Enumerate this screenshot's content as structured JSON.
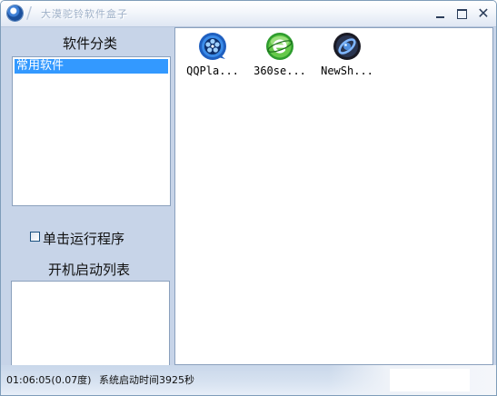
{
  "window": {
    "title": "大漠驼铃软件盒子"
  },
  "left_panel": {
    "category_label": "软件分类",
    "category_items": [
      {
        "label": "常用软件",
        "selected": true
      }
    ],
    "single_click_checkbox": {
      "label": "单击运行程序",
      "checked": false
    },
    "startup_label": "开机启动列表",
    "startup_items": []
  },
  "content": {
    "apps": [
      {
        "label": "QQPla...",
        "icon": "qqplayer-icon"
      },
      {
        "label": "360se...",
        "icon": "360se-browser-icon"
      },
      {
        "label": "NewSh...",
        "icon": "newsh-icon"
      }
    ]
  },
  "statusbar": {
    "time": "01:06:05(0.07度)",
    "boot_time": "系统启动时间3925秒"
  },
  "colors": {
    "selection": "#3399ff",
    "window_bg": "#c7d4e8",
    "border": "#8aa0bd"
  }
}
